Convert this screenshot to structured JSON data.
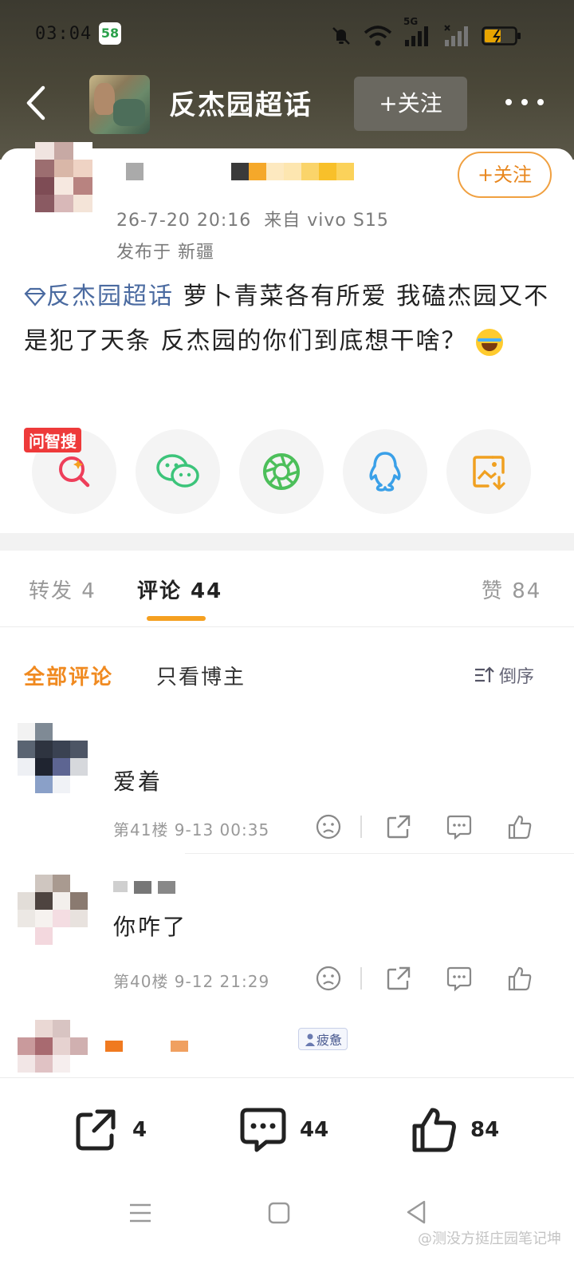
{
  "status_bar": {
    "time": "03:04",
    "app_badge": "58",
    "network": "5G"
  },
  "header": {
    "title": "反杰园超话",
    "follow_label": "+关注"
  },
  "post": {
    "follow_label": "+关注",
    "time": "26-7-20 20:16",
    "source": "来自 vivo S15",
    "location": "发布于 新疆",
    "topic_link": "反杰园超话",
    "body": "萝卜青菜各有所爱 我磕杰园又不是犯了天条 反杰园的你们到底想干啥？",
    "share_badge": "问智搜"
  },
  "tabs": {
    "repost": "转发 4",
    "comments": "评论 44",
    "likes": "赞 84"
  },
  "filters": {
    "all": "全部评论",
    "author_only": "只看博主",
    "sort": "倒序"
  },
  "comments": [
    {
      "text": "爱着",
      "meta": "第41楼 9-13 00:35"
    },
    {
      "text": "你咋了",
      "meta": "第40楼 9-12 21:29"
    }
  ],
  "bottom_bar": {
    "repost_count": "4",
    "comment_count": "44",
    "like_count": "84"
  },
  "third_comment_badge": "疲惫",
  "watermark": "@测没方挺庄园笔记坤",
  "colors": {
    "accent_orange": "#f08a20",
    "topic_blue": "#4a6aa0",
    "header_bg": "#403d31"
  }
}
